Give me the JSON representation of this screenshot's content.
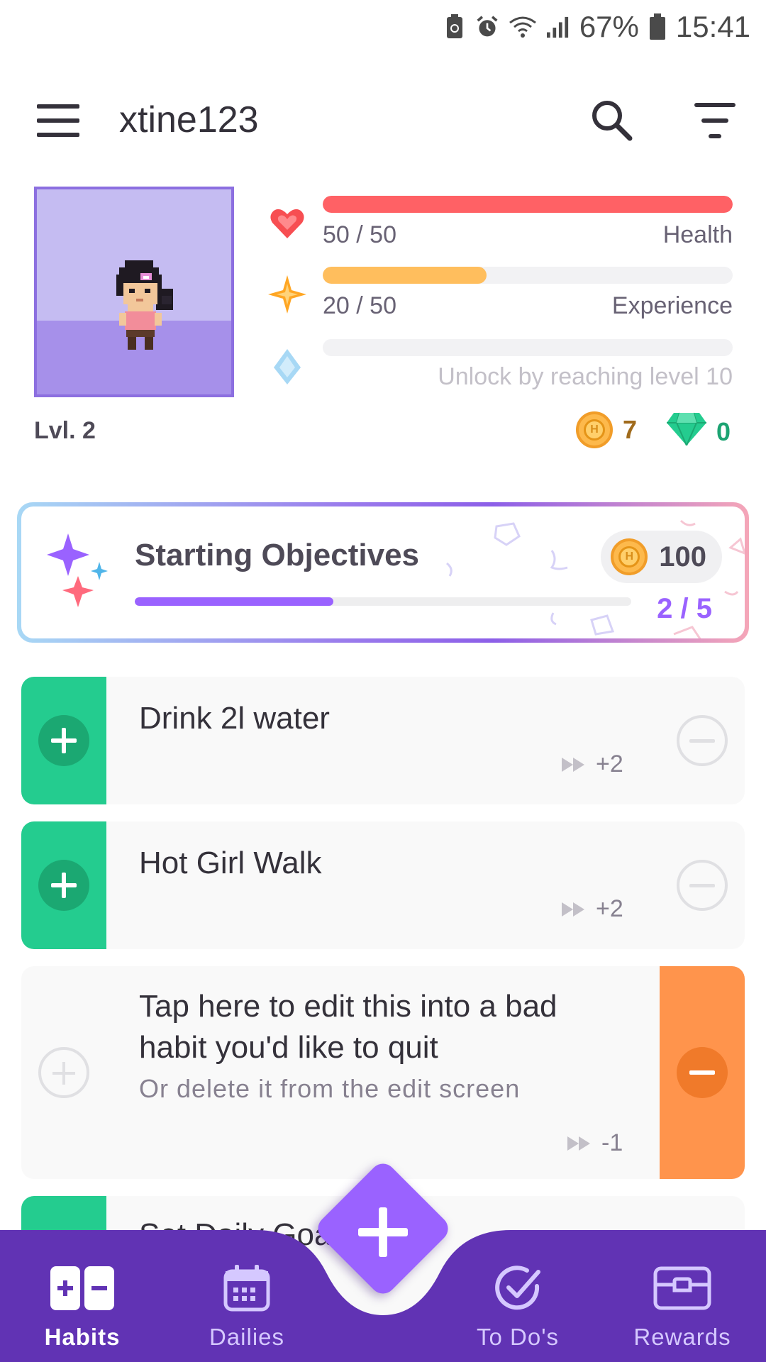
{
  "status_bar": {
    "battery_pct": "67%",
    "time": "15:41"
  },
  "appbar": {
    "username": "xtine123"
  },
  "stats": {
    "level": "Lvl. 2",
    "health": {
      "text": "50 / 50",
      "label": "Health",
      "fraction": 1.0,
      "color": "#ff6165"
    },
    "experience": {
      "text": "20 / 50",
      "label": "Experience",
      "fraction": 0.4,
      "color": "#ffbe5d"
    },
    "mana": {
      "label": "Unlock by reaching level 10",
      "fraction": 0.0
    },
    "gold": "7",
    "gems": "0"
  },
  "objectives": {
    "title": "Starting Objectives",
    "reward": "100",
    "count": "2 / 5",
    "progress": 0.4
  },
  "habits": [
    {
      "title": "Drink 2l water",
      "streak": "+2"
    },
    {
      "title": "Hot Girl Walk",
      "streak": "+2"
    },
    {
      "title": "Tap here to edit this into a bad habit you'd like to quit",
      "notes": "Or delete it from the edit screen",
      "streak": "-1"
    },
    {
      "title": "Set Daily Goals"
    }
  ],
  "nav": {
    "habits": "Habits",
    "dailies": "Dailies",
    "todos": "To Do's",
    "rewards": "Rewards"
  },
  "colors": {
    "nav_bg": "#6133b4",
    "accent": "#9a62ff",
    "positive": "#24cc8f",
    "negative": "#ff944c"
  }
}
